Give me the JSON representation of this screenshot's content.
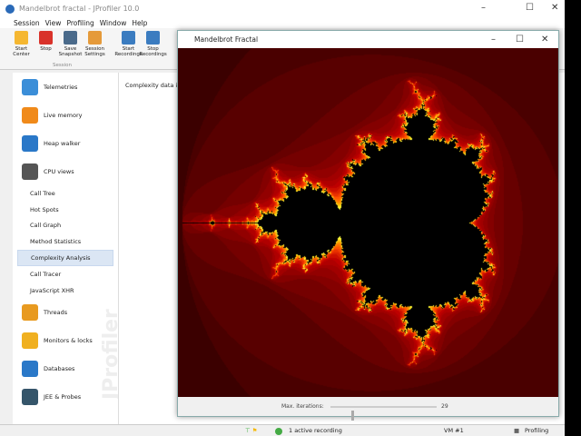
{
  "app": {
    "title": "Mandelbrot fractal - JProfiler 10.0"
  },
  "menu": [
    "Session",
    "View",
    "Profiling",
    "Window",
    "Help"
  ],
  "toolbar": [
    {
      "label": "Start Center",
      "icon": "folder-play-icon",
      "color": "#f5b731"
    },
    {
      "label": "Stop",
      "icon": "stop-icon",
      "color": "#d9322a"
    },
    {
      "label": "Save Snapshot",
      "icon": "save-icon",
      "color": "#4a6a8a"
    },
    {
      "label": "Session Settings",
      "icon": "settings-icon",
      "color": "#e59a3a"
    },
    {
      "label": "Start Recordings",
      "icon": "start-recordings-icon",
      "color": "#3b7cc0"
    },
    {
      "label": "Stop Recordings",
      "icon": "stop-recordings-icon",
      "color": "#3b7cc0"
    }
  ],
  "toolbar_group": "Session",
  "sidebar": {
    "items": [
      {
        "label": "Telemetries",
        "color": "#3b8ed8"
      },
      {
        "label": "Live memory",
        "color": "#f08a1a"
      },
      {
        "label": "Heap walker",
        "color": "#2a78c8"
      },
      {
        "label": "CPU views",
        "color": "#555"
      }
    ],
    "sub": [
      "Call Tree",
      "Hot Spots",
      "Call Graph",
      "Method Statistics",
      "Complexity Analysis",
      "Call Tracer",
      "JavaScript XHR"
    ],
    "selected": "Complexity Analysis",
    "items2": [
      {
        "label": "Threads",
        "color": "#e89a20"
      },
      {
        "label": "Monitors & locks",
        "color": "#f0b020"
      },
      {
        "label": "Databases",
        "color": "#2a78c8"
      },
      {
        "label": "JEE & Probes",
        "color": "#35556a"
      }
    ],
    "watermark": "JProfiler"
  },
  "content": {
    "text": "Complexity data is"
  },
  "fractal_window": {
    "title": "Mandelbrot Fractal",
    "slider_label": "Max. iterations:",
    "iterations": "29",
    "slider_fraction": 0.2
  },
  "status": {
    "recording": "1 active recording",
    "vm": "VM #1",
    "mode": "Profiling"
  }
}
